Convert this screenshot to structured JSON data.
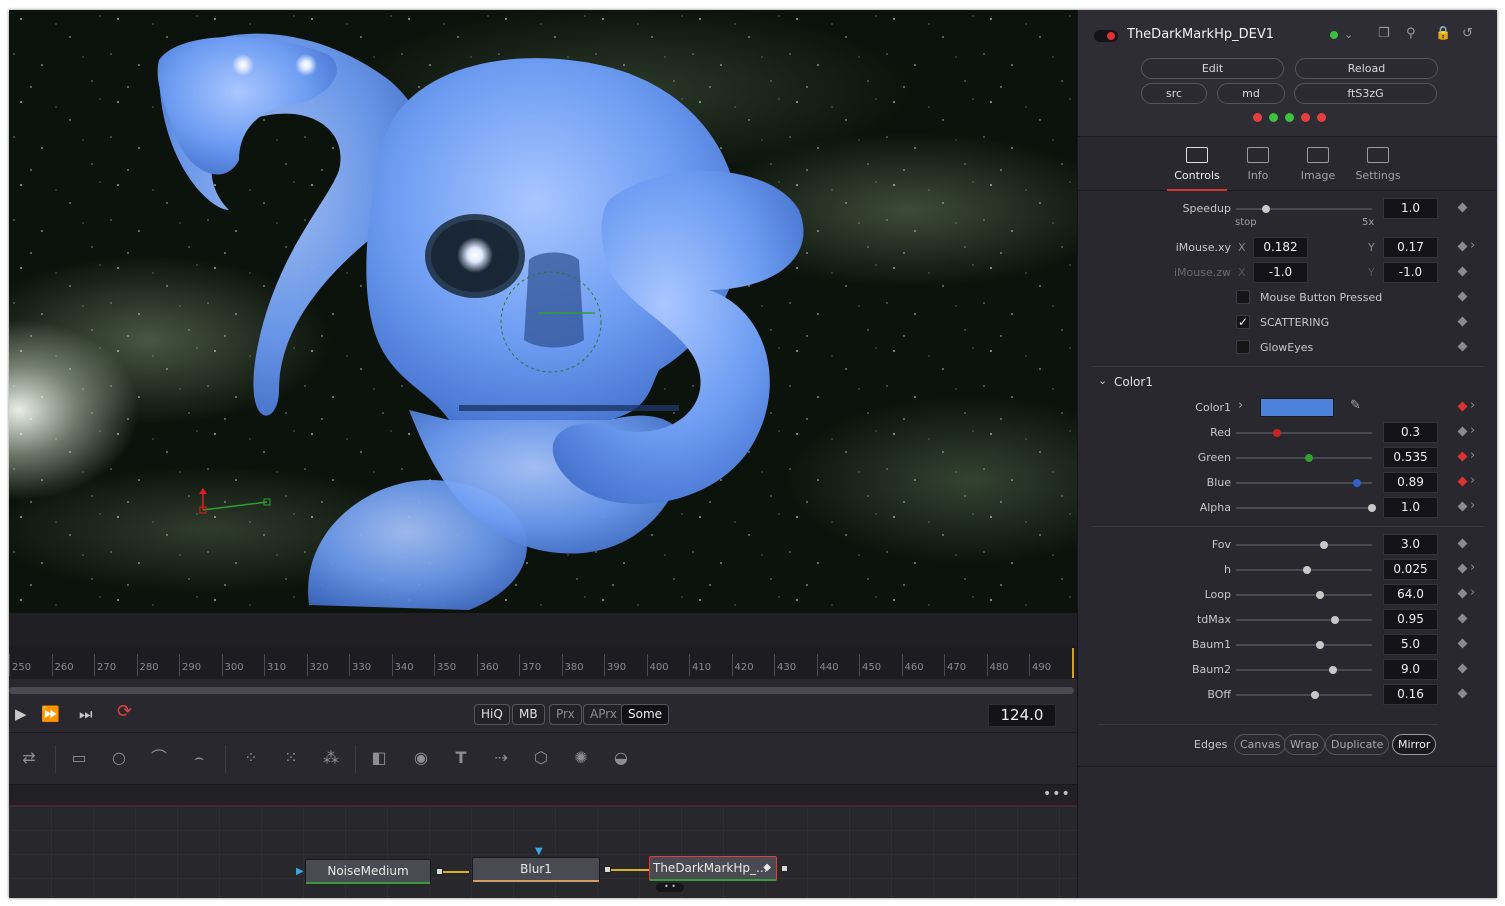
{
  "viewer": {
    "transport": {
      "play": "▶",
      "ffwd": "⏩",
      "end": "⏭",
      "loop": "⟳"
    },
    "quality_buttons": [
      "HiQ",
      "MB",
      "Prx",
      "APrx",
      "Some"
    ],
    "frame": "124.0",
    "ruler_labels": [
      "250",
      "260",
      "270",
      "280",
      "290",
      "300",
      "310",
      "320",
      "330",
      "340",
      "350",
      "360",
      "370",
      "380",
      "390",
      "400",
      "410",
      "420",
      "430",
      "440",
      "450",
      "460",
      "470",
      "480",
      "490"
    ]
  },
  "nodes": {
    "more": "•••",
    "items": [
      {
        "label": "NoiseMedium",
        "bar_color": "#3a9a40"
      },
      {
        "label": "Blur1",
        "bar_color": "#d0a060"
      },
      {
        "label": "TheDarkMarkHp_...",
        "bar_color": "#3a9a40"
      }
    ]
  },
  "inspector": {
    "title": "TheDarkMarkHp_DEV1",
    "buttons": {
      "edit": "Edit",
      "reload": "Reload",
      "src": "src",
      "md": "md",
      "code": "ftS3zG"
    },
    "dot_colors": [
      "#e84040",
      "#40c040",
      "#40c040",
      "#e84040",
      "#e84040"
    ],
    "tabs": [
      {
        "label": "Controls"
      },
      {
        "label": "Info"
      },
      {
        "label": "Image"
      },
      {
        "label": "Settings"
      }
    ],
    "speedup": {
      "label": "Speedup",
      "value": "1.0",
      "min_label": "stop",
      "max_label": "5x",
      "level": 0.22
    },
    "imouse_xy": {
      "label": "iMouse.xy",
      "x_label": "X",
      "x": "0.182",
      "y_label": "Y",
      "y": "0.17"
    },
    "imouse_zw": {
      "label": "iMouse.zw",
      "x_label": "X",
      "x": "-1.0",
      "y_label": "Y",
      "y": "-1.0"
    },
    "checks": [
      {
        "label": "Mouse Button Pressed",
        "checked": ""
      },
      {
        "label": "SCATTERING",
        "checked": "✓"
      },
      {
        "label": "GlowEyes",
        "checked": ""
      }
    ],
    "color_section": {
      "header": "Color1",
      "label": "Color1",
      "swatch": "#4c82dc"
    },
    "color_sliders": [
      {
        "label": "Red",
        "value": "0.3",
        "level": 0.3,
        "knob": "#d02020"
      },
      {
        "label": "Green",
        "value": "0.535",
        "level": 0.535,
        "knob": "#30a030"
      },
      {
        "label": "Blue",
        "value": "0.89",
        "level": 0.89,
        "knob": "#3060d0"
      },
      {
        "label": "Alpha",
        "value": "1.0",
        "level": 1.0,
        "knob": "#c8c8c8"
      }
    ],
    "sliders": [
      {
        "label": "Fov",
        "value": "3.0",
        "level": 0.65
      },
      {
        "label": "h",
        "value": "0.025",
        "level": 0.52
      },
      {
        "label": "Loop",
        "value": "64.0",
        "level": 0.62
      },
      {
        "label": "tdMax",
        "value": "0.95",
        "level": 0.73
      },
      {
        "label": "Baum1",
        "value": "5.0",
        "level": 0.62
      },
      {
        "label": "Baum2",
        "value": "9.0",
        "level": 0.71
      },
      {
        "label": "BOff",
        "value": "0.16",
        "level": 0.58
      }
    ],
    "edges": {
      "label": "Edges",
      "options": [
        "Canvas",
        "Wrap",
        "Duplicate",
        "Mirror"
      ],
      "selected": "Mirror"
    }
  }
}
